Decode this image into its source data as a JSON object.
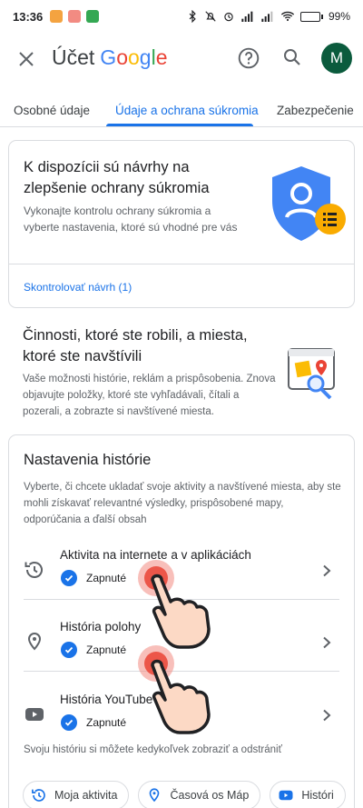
{
  "status_bar": {
    "time": "13:36",
    "battery": "99"
  },
  "header": {
    "prefix": "Účet",
    "brand": [
      {
        "ch": "G",
        "color": "#4285F4"
      },
      {
        "ch": "o",
        "color": "#EA4335"
      },
      {
        "ch": "o",
        "color": "#FBBC05"
      },
      {
        "ch": "g",
        "color": "#4285F4"
      },
      {
        "ch": "l",
        "color": "#34A853"
      },
      {
        "ch": "e",
        "color": "#EA4335"
      }
    ],
    "avatar_initial": "M"
  },
  "tabs": [
    {
      "label": "Osobné údaje"
    },
    {
      "label": "Údaje a ochrana súkromia"
    },
    {
      "label": "Zabezpečenie"
    }
  ],
  "privacy_card": {
    "heading": "K dispozícii sú návrhy na zlepšenie ochrany súkromia",
    "description": "Vykonajte kontrolu ochrany súkromia a vyberte nastavenia, ktoré sú vhodné pre vás",
    "link": "Skontrolovať návrh (1)"
  },
  "activity_section": {
    "heading": "Činnosti, ktoré ste robili, a miesta, ktoré ste navštívili",
    "description": "Vaše možnosti histórie, reklám a prispôsobenia. Znova objavujte položky, ktoré ste vyhľadávali, čítali a pozerali, a zobrazte si navštívené miesta."
  },
  "history_card": {
    "heading": "Nastavenia histórie",
    "description": "Vyberte, či chcete ukladať svoje aktivity a navštívené miesta, aby ste mohli získavať relevantné výsledky, prispôsobené mapy, odporúčania a ďalší obsah",
    "rows": [
      {
        "label": "Aktivita na internete a v aplikáciách",
        "status": "Zapnuté",
        "icon": "history-icon"
      },
      {
        "label": "História polohy",
        "status": "Zapnuté",
        "icon": "location-pin-icon"
      },
      {
        "label": "História YouTube",
        "status": "Zapnuté",
        "icon": "youtube-icon"
      }
    ],
    "note": "Svoju históriu si môžete kedykoľvek zobraziť a odstrániť"
  },
  "chips": [
    {
      "label": "Moja aktivita",
      "icon": "history-icon"
    },
    {
      "label": "Časová os Máp",
      "icon": "location-pin-icon"
    },
    {
      "label": "Históri",
      "icon": "youtube-icon"
    }
  ],
  "colors": {
    "accent": "#1a73e8",
    "avatar": "#0b5b3d",
    "shield": "#4285f4",
    "badge": "#f9ab00"
  }
}
